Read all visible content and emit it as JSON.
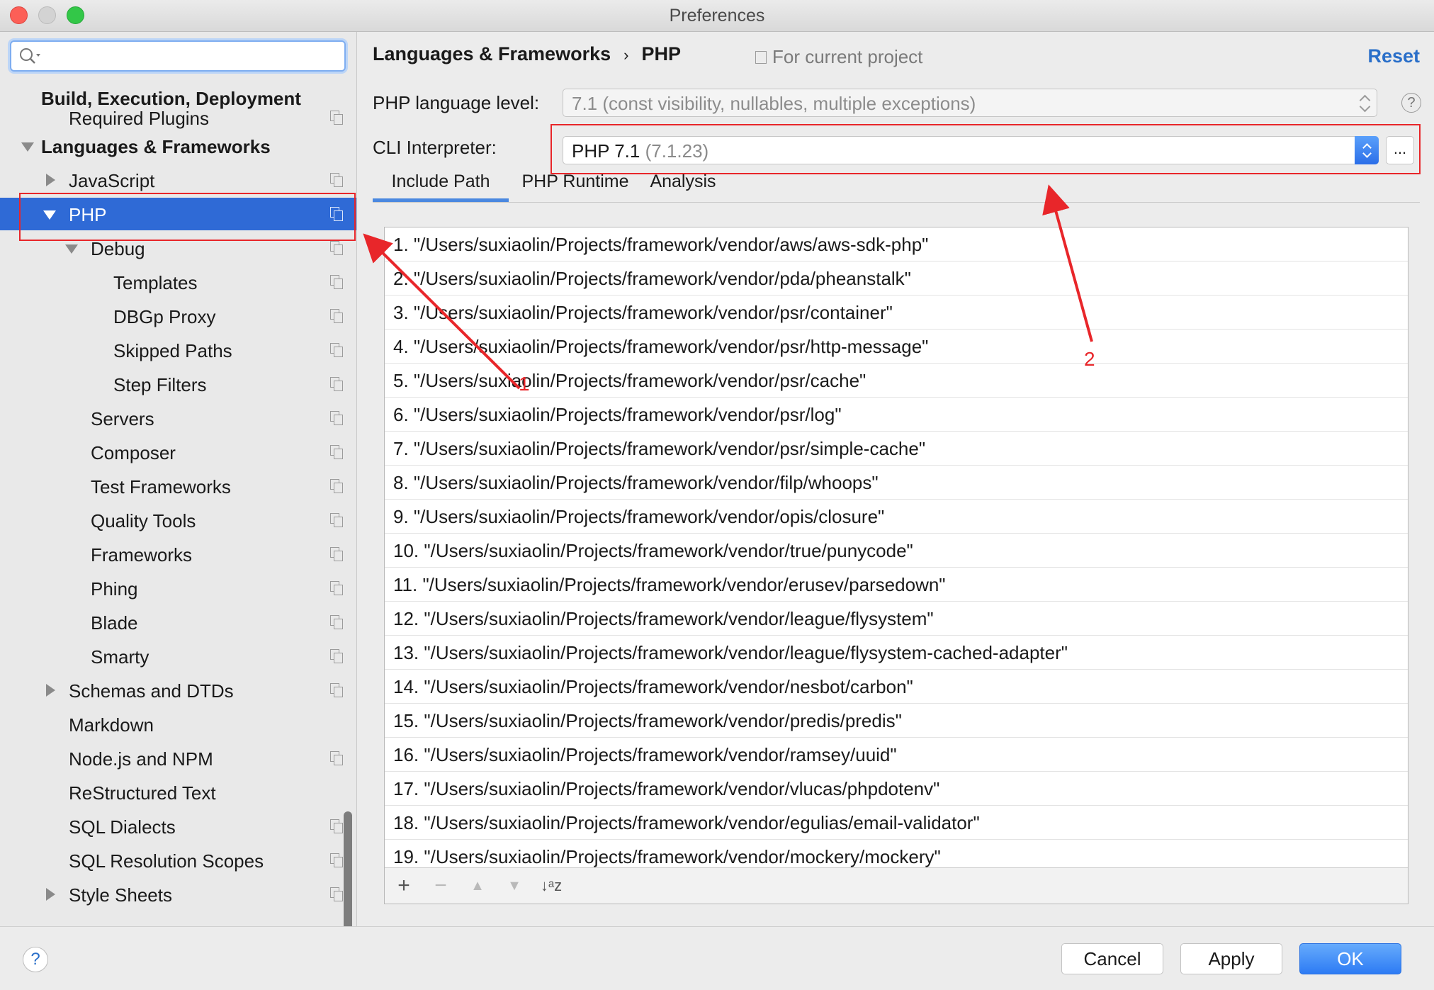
{
  "window": {
    "title": "Preferences"
  },
  "sidebar": {
    "search": {
      "value": "",
      "placeholder": ""
    },
    "items": [
      {
        "label": "Build, Execution, Deployment",
        "bold": true,
        "indent": 0,
        "toggle": "none",
        "copy": false,
        "y": 0
      },
      {
        "label": "Required Plugins",
        "indent": 1,
        "toggle": "none",
        "copy": true
      },
      {
        "label": "Languages & Frameworks",
        "bold": true,
        "indent": 0,
        "toggle": "down",
        "copy": false
      },
      {
        "label": "JavaScript",
        "indent": 1,
        "toggle": "right",
        "copy": true
      },
      {
        "label": "PHP",
        "indent": 1,
        "toggle": "down",
        "copy": true,
        "selected": true
      },
      {
        "label": "Debug",
        "indent": 2,
        "toggle": "down",
        "copy": true
      },
      {
        "label": "Templates",
        "indent": 3,
        "toggle": "none",
        "copy": true
      },
      {
        "label": "DBGp Proxy",
        "indent": 3,
        "toggle": "none",
        "copy": true
      },
      {
        "label": "Skipped Paths",
        "indent": 3,
        "toggle": "none",
        "copy": true
      },
      {
        "label": "Step Filters",
        "indent": 3,
        "toggle": "none",
        "copy": true
      },
      {
        "label": "Servers",
        "indent": 2,
        "toggle": "none",
        "copy": true
      },
      {
        "label": "Composer",
        "indent": 2,
        "toggle": "none",
        "copy": true
      },
      {
        "label": "Test Frameworks",
        "indent": 2,
        "toggle": "none",
        "copy": true
      },
      {
        "label": "Quality Tools",
        "indent": 2,
        "toggle": "none",
        "copy": true
      },
      {
        "label": "Frameworks",
        "indent": 2,
        "toggle": "none",
        "copy": true
      },
      {
        "label": "Phing",
        "indent": 2,
        "toggle": "none",
        "copy": true
      },
      {
        "label": "Blade",
        "indent": 2,
        "toggle": "none",
        "copy": true
      },
      {
        "label": "Smarty",
        "indent": 2,
        "toggle": "none",
        "copy": true
      },
      {
        "label": "Schemas and DTDs",
        "indent": 1,
        "toggle": "right",
        "copy": true
      },
      {
        "label": "Markdown",
        "indent": 1,
        "toggle": "none",
        "copy": false
      },
      {
        "label": "Node.js and NPM",
        "indent": 1,
        "toggle": "none",
        "copy": true
      },
      {
        "label": "ReStructured Text",
        "indent": 1,
        "toggle": "none",
        "copy": false
      },
      {
        "label": "SQL Dialects",
        "indent": 1,
        "toggle": "none",
        "copy": true
      },
      {
        "label": "SQL Resolution Scopes",
        "indent": 1,
        "toggle": "none",
        "copy": true
      },
      {
        "label": "Style Sheets",
        "indent": 1,
        "toggle": "right",
        "copy": true
      }
    ]
  },
  "main": {
    "breadcrumb": {
      "parent": "Languages & Frameworks",
      "separator": "›",
      "current": "PHP"
    },
    "scope_label": "For current project",
    "reset_label": "Reset",
    "language_level": {
      "label": "PHP language level:",
      "value": "7.1 (const visibility, nullables, multiple exceptions)"
    },
    "cli_interpreter": {
      "label": "CLI Interpreter:",
      "name": "PHP 7.1",
      "version": "(7.1.23)",
      "more_label": "..."
    },
    "help_label": "?",
    "tabs": [
      {
        "label": "Include Path",
        "active": true
      },
      {
        "label": "PHP Runtime",
        "active": false
      },
      {
        "label": "Analysis",
        "active": false
      }
    ],
    "include_paths": [
      "1. \"/Users/suxiaolin/Projects/framework/vendor/aws/aws-sdk-php\"",
      "2. \"/Users/suxiaolin/Projects/framework/vendor/pda/pheanstalk\"",
      "3. \"/Users/suxiaolin/Projects/framework/vendor/psr/container\"",
      "4. \"/Users/suxiaolin/Projects/framework/vendor/psr/http-message\"",
      "5. \"/Users/suxiaolin/Projects/framework/vendor/psr/cache\"",
      "6. \"/Users/suxiaolin/Projects/framework/vendor/psr/log\"",
      "7. \"/Users/suxiaolin/Projects/framework/vendor/psr/simple-cache\"",
      "8. \"/Users/suxiaolin/Projects/framework/vendor/filp/whoops\"",
      "9. \"/Users/suxiaolin/Projects/framework/vendor/opis/closure\"",
      "10. \"/Users/suxiaolin/Projects/framework/vendor/true/punycode\"",
      "11. \"/Users/suxiaolin/Projects/framework/vendor/erusev/parsedown\"",
      "12. \"/Users/suxiaolin/Projects/framework/vendor/league/flysystem\"",
      "13. \"/Users/suxiaolin/Projects/framework/vendor/league/flysystem-cached-adapter\"",
      "14. \"/Users/suxiaolin/Projects/framework/vendor/nesbot/carbon\"",
      "15. \"/Users/suxiaolin/Projects/framework/vendor/predis/predis\"",
      "16. \"/Users/suxiaolin/Projects/framework/vendor/ramsey/uuid\"",
      "17. \"/Users/suxiaolin/Projects/framework/vendor/vlucas/phpdotenv\"",
      "18. \"/Users/suxiaolin/Projects/framework/vendor/egulias/email-validator\"",
      "19. \"/Users/suxiaolin/Projects/framework/vendor/mockery/mockery\""
    ],
    "toolbar": {
      "add": "+",
      "remove": "−",
      "up": "▲",
      "down": "▼",
      "sort": "↓ᵃz"
    }
  },
  "annotations": {
    "arrow1_label": "1",
    "arrow2_label": "2",
    "color": "#e8262a"
  },
  "footer": {
    "help": "?",
    "cancel": "Cancel",
    "apply": "Apply",
    "ok": "OK"
  },
  "colors": {
    "selection": "#2f6ad6",
    "accent": "#2d7bf4",
    "link": "#2a6fc9"
  }
}
